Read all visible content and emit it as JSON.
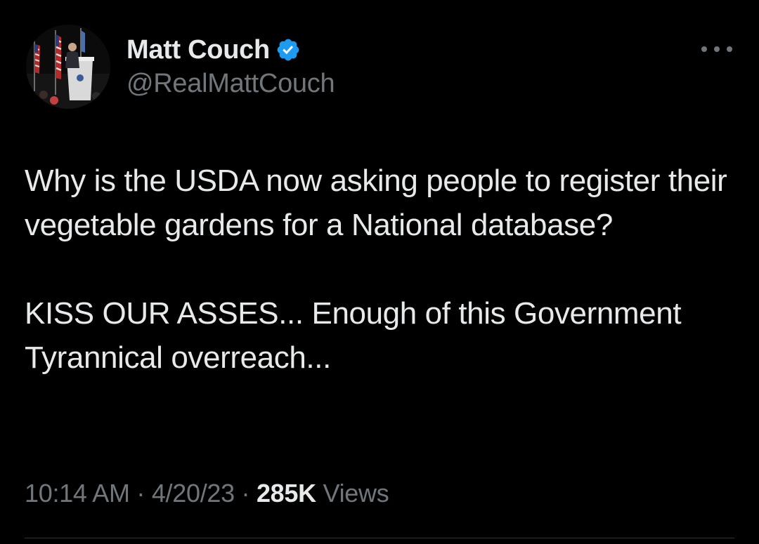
{
  "tweet": {
    "author": {
      "display_name": "Matt Couch",
      "handle": "@RealMattCouch",
      "verified": true,
      "verified_icon": "verified-badge-icon",
      "verified_color": "#1d9bf0"
    },
    "more_icon": "more-options-icon",
    "text": {
      "paragraph_1": "Why is the USDA now asking people to register their vegetable gardens for a National database?",
      "paragraph_2": "KISS OUR ASSES... Enough of this Government Tyrannical overreach..."
    },
    "meta": {
      "time": "10:14 AM",
      "date": "4/20/23",
      "separator": "·",
      "views_count": "285K",
      "views_label": "Views"
    }
  },
  "colors": {
    "background": "#000000",
    "primary_text": "#e7e9ea",
    "secondary_text": "#71767b",
    "divider": "#2f3336"
  }
}
